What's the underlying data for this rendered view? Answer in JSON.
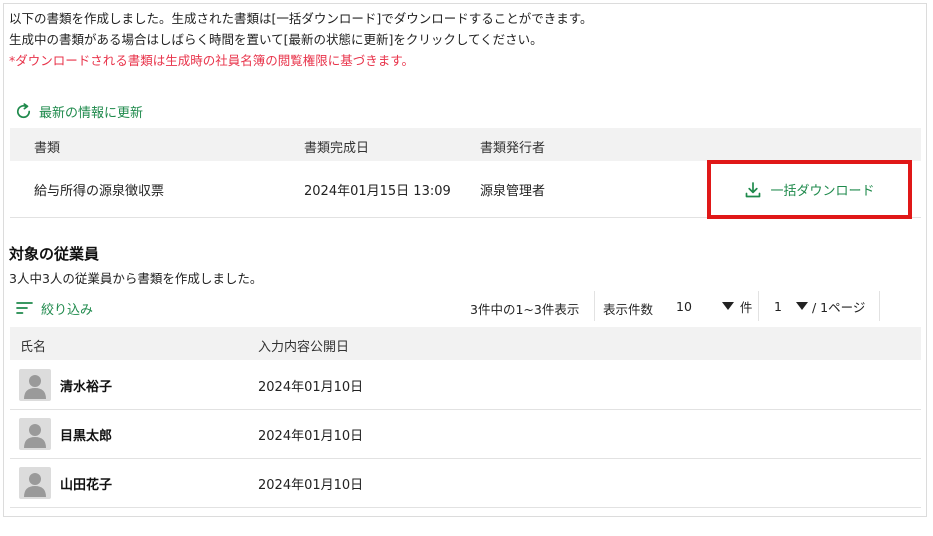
{
  "messages": {
    "line1": "以下の書類を作成しました。生成された書類は[一括ダウンロード]でダウンロードすることができます。",
    "line2": "生成中の書類がある場合はしばらく時間を置いて[最新の状態に更新]をクリックしてください。",
    "note": "*ダウンロードされる書類は生成時の社員名簿の閲覧権限に基づきます。"
  },
  "refresh_label": "最新の情報に更新",
  "documents_table": {
    "columns": [
      "書類",
      "書類完成日",
      "書類発行者"
    ],
    "rows": [
      {
        "document": "給与所得の源泉徴収票",
        "completed": "2024年01月15日 13:09",
        "issuer": "源泉管理者"
      }
    ],
    "download_label": "一括ダウンロード"
  },
  "employees": {
    "title": "対象の従業員",
    "subtitle": "3人中3人の従業員から書類を作成しました。",
    "filter_label": "絞り込み",
    "pagination": {
      "count_text": "3件中の1~3件表示",
      "per_page_label": "表示件数",
      "per_page_value": "10",
      "per_page_unit": "件",
      "page_value": "1",
      "page_total": "/ 1ページ"
    },
    "columns": [
      "氏名",
      "入力内容公開日"
    ],
    "rows": [
      {
        "name": "清水裕子",
        "date": "2024年01月10日"
      },
      {
        "name": "目黒太郎",
        "date": "2024年01月10日"
      },
      {
        "name": "山田花子",
        "date": "2024年01月10日"
      }
    ]
  },
  "colors": {
    "accent": "#1f8a4c",
    "note_red": "#e8334a",
    "highlight_border": "#e01818",
    "header_bg": "#f2f2f2"
  },
  "icons": {
    "refresh": "refresh-icon",
    "download": "download-icon",
    "filter": "filter-icon",
    "avatar": "user-avatar-icon",
    "dropdown": "caret-down-icon"
  }
}
